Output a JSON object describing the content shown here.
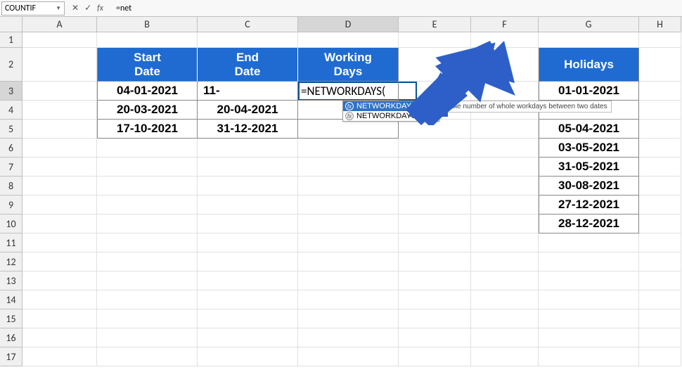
{
  "formula_bar": {
    "name_box": "COUNTIF",
    "cancel": "✕",
    "confirm": "✓",
    "fx": "fx",
    "value": "=net"
  },
  "columns": [
    "A",
    "B",
    "C",
    "D",
    "E",
    "F",
    "G",
    "H"
  ],
  "rows": [
    "1",
    "2",
    "3",
    "4",
    "5",
    "6",
    "7",
    "8",
    "9",
    "10",
    "11",
    "12",
    "13",
    "14",
    "15",
    "16",
    "17"
  ],
  "headers": {
    "start_date": "Start\nDate",
    "end_date": "End\nDate",
    "working_days": "Working\nDays",
    "holidays": "Holidays"
  },
  "table": {
    "b3": "04-01-2021",
    "c3": "11-",
    "b4": "20-03-2021",
    "c4": "20-04-2021",
    "b5": "17-10-2021",
    "c5": "31-12-2021"
  },
  "formula_cell": "=NETWORKDAYS(",
  "holidays": {
    "g3": "01-01-2021",
    "g5": "05-04-2021",
    "g6": "03-05-2021",
    "g7": "31-05-2021",
    "g8": "30-08-2021",
    "g9": "27-12-2021",
    "g10": "28-12-2021"
  },
  "autocomplete": {
    "item1": "NETWORKDAYS",
    "item2": "NETWORKDAYS.INTL",
    "tooltip": "Returns the number of whole workdays between two dates"
  }
}
